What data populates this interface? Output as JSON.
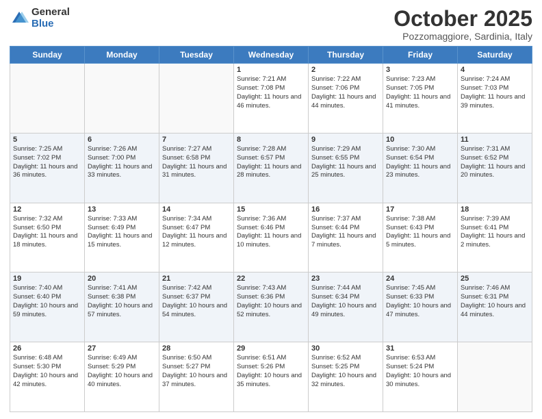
{
  "logo": {
    "general": "General",
    "blue": "Blue"
  },
  "header": {
    "month": "October 2025",
    "location": "Pozzomaggiore, Sardinia, Italy"
  },
  "days": [
    "Sunday",
    "Monday",
    "Tuesday",
    "Wednesday",
    "Thursday",
    "Friday",
    "Saturday"
  ],
  "weeks": [
    [
      {
        "num": "",
        "info": ""
      },
      {
        "num": "",
        "info": ""
      },
      {
        "num": "",
        "info": ""
      },
      {
        "num": "1",
        "info": "Sunrise: 7:21 AM\nSunset: 7:08 PM\nDaylight: 11 hours and 46 minutes."
      },
      {
        "num": "2",
        "info": "Sunrise: 7:22 AM\nSunset: 7:06 PM\nDaylight: 11 hours and 44 minutes."
      },
      {
        "num": "3",
        "info": "Sunrise: 7:23 AM\nSunset: 7:05 PM\nDaylight: 11 hours and 41 minutes."
      },
      {
        "num": "4",
        "info": "Sunrise: 7:24 AM\nSunset: 7:03 PM\nDaylight: 11 hours and 39 minutes."
      }
    ],
    [
      {
        "num": "5",
        "info": "Sunrise: 7:25 AM\nSunset: 7:02 PM\nDaylight: 11 hours and 36 minutes."
      },
      {
        "num": "6",
        "info": "Sunrise: 7:26 AM\nSunset: 7:00 PM\nDaylight: 11 hours and 33 minutes."
      },
      {
        "num": "7",
        "info": "Sunrise: 7:27 AM\nSunset: 6:58 PM\nDaylight: 11 hours and 31 minutes."
      },
      {
        "num": "8",
        "info": "Sunrise: 7:28 AM\nSunset: 6:57 PM\nDaylight: 11 hours and 28 minutes."
      },
      {
        "num": "9",
        "info": "Sunrise: 7:29 AM\nSunset: 6:55 PM\nDaylight: 11 hours and 25 minutes."
      },
      {
        "num": "10",
        "info": "Sunrise: 7:30 AM\nSunset: 6:54 PM\nDaylight: 11 hours and 23 minutes."
      },
      {
        "num": "11",
        "info": "Sunrise: 7:31 AM\nSunset: 6:52 PM\nDaylight: 11 hours and 20 minutes."
      }
    ],
    [
      {
        "num": "12",
        "info": "Sunrise: 7:32 AM\nSunset: 6:50 PM\nDaylight: 11 hours and 18 minutes."
      },
      {
        "num": "13",
        "info": "Sunrise: 7:33 AM\nSunset: 6:49 PM\nDaylight: 11 hours and 15 minutes."
      },
      {
        "num": "14",
        "info": "Sunrise: 7:34 AM\nSunset: 6:47 PM\nDaylight: 11 hours and 12 minutes."
      },
      {
        "num": "15",
        "info": "Sunrise: 7:36 AM\nSunset: 6:46 PM\nDaylight: 11 hours and 10 minutes."
      },
      {
        "num": "16",
        "info": "Sunrise: 7:37 AM\nSunset: 6:44 PM\nDaylight: 11 hours and 7 minutes."
      },
      {
        "num": "17",
        "info": "Sunrise: 7:38 AM\nSunset: 6:43 PM\nDaylight: 11 hours and 5 minutes."
      },
      {
        "num": "18",
        "info": "Sunrise: 7:39 AM\nSunset: 6:41 PM\nDaylight: 11 hours and 2 minutes."
      }
    ],
    [
      {
        "num": "19",
        "info": "Sunrise: 7:40 AM\nSunset: 6:40 PM\nDaylight: 10 hours and 59 minutes."
      },
      {
        "num": "20",
        "info": "Sunrise: 7:41 AM\nSunset: 6:38 PM\nDaylight: 10 hours and 57 minutes."
      },
      {
        "num": "21",
        "info": "Sunrise: 7:42 AM\nSunset: 6:37 PM\nDaylight: 10 hours and 54 minutes."
      },
      {
        "num": "22",
        "info": "Sunrise: 7:43 AM\nSunset: 6:36 PM\nDaylight: 10 hours and 52 minutes."
      },
      {
        "num": "23",
        "info": "Sunrise: 7:44 AM\nSunset: 6:34 PM\nDaylight: 10 hours and 49 minutes."
      },
      {
        "num": "24",
        "info": "Sunrise: 7:45 AM\nSunset: 6:33 PM\nDaylight: 10 hours and 47 minutes."
      },
      {
        "num": "25",
        "info": "Sunrise: 7:46 AM\nSunset: 6:31 PM\nDaylight: 10 hours and 44 minutes."
      }
    ],
    [
      {
        "num": "26",
        "info": "Sunrise: 6:48 AM\nSunset: 5:30 PM\nDaylight: 10 hours and 42 minutes."
      },
      {
        "num": "27",
        "info": "Sunrise: 6:49 AM\nSunset: 5:29 PM\nDaylight: 10 hours and 40 minutes."
      },
      {
        "num": "28",
        "info": "Sunrise: 6:50 AM\nSunset: 5:27 PM\nDaylight: 10 hours and 37 minutes."
      },
      {
        "num": "29",
        "info": "Sunrise: 6:51 AM\nSunset: 5:26 PM\nDaylight: 10 hours and 35 minutes."
      },
      {
        "num": "30",
        "info": "Sunrise: 6:52 AM\nSunset: 5:25 PM\nDaylight: 10 hours and 32 minutes."
      },
      {
        "num": "31",
        "info": "Sunrise: 6:53 AM\nSunset: 5:24 PM\nDaylight: 10 hours and 30 minutes."
      },
      {
        "num": "",
        "info": ""
      }
    ]
  ]
}
